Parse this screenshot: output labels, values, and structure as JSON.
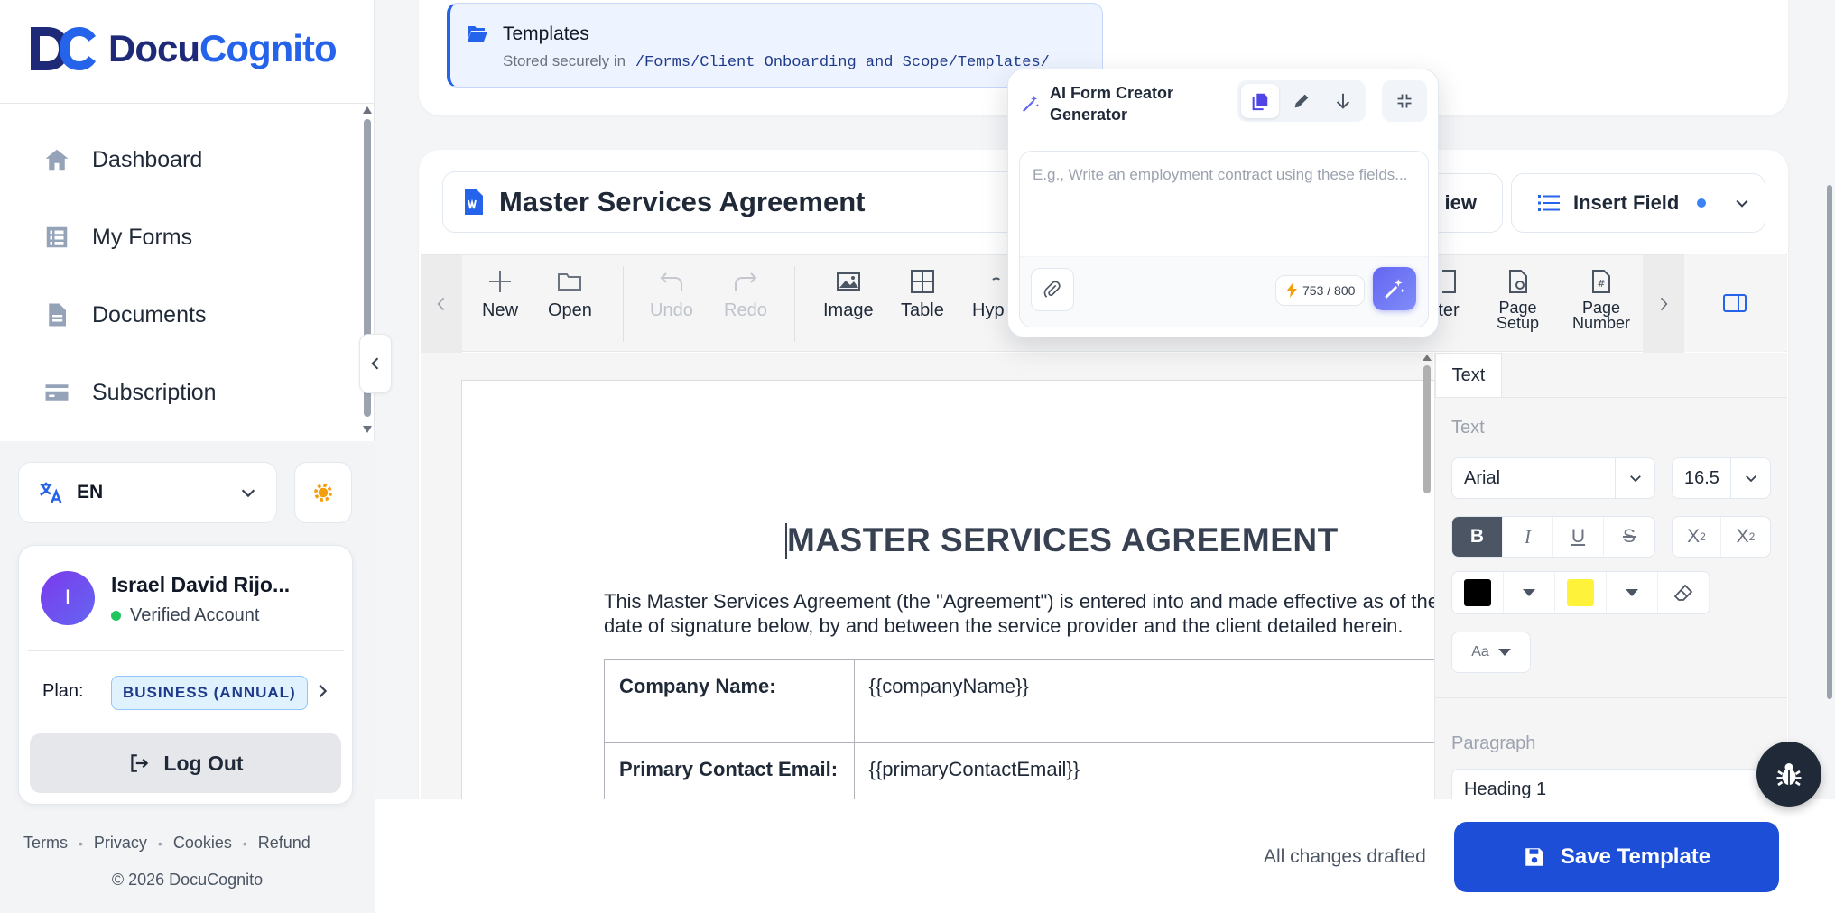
{
  "brand": {
    "part1": "Docu",
    "part2": "Cognito"
  },
  "nav": [
    {
      "label": "Dashboard",
      "icon": "home-icon"
    },
    {
      "label": "My Forms",
      "icon": "list-icon"
    },
    {
      "label": "Documents",
      "icon": "document-icon"
    },
    {
      "label": "Subscription",
      "icon": "credit-card-icon"
    }
  ],
  "language": {
    "code": "EN"
  },
  "user": {
    "initial": "I",
    "name": "Israel David Rijo...",
    "status": "Verified Account",
    "plan_label": "Plan:",
    "plan": "BUSINESS (ANNUAL)",
    "logout": "Log Out"
  },
  "footer": {
    "links": [
      "Terms",
      "Privacy",
      "Cookies",
      "Refund"
    ],
    "copyright": "© 2026  DocuCognito"
  },
  "templates_info": {
    "title": "Templates",
    "stored_prefix": "Stored securely in",
    "path": "/Forms/Client Onboarding and Scope/Templates/"
  },
  "document": {
    "title": "Master Services Agreement"
  },
  "header_buttons": {
    "preview_partial": "iew",
    "insert_field": "Insert Field"
  },
  "toolbar": {
    "new": "New",
    "open": "Open",
    "undo": "Undo",
    "redo": "Redo",
    "image": "Image",
    "table": "Table",
    "hyperlink_partial": "Hyp",
    "footer_partial": "ter",
    "page_setup_1": "Page",
    "page_setup_2": "Setup",
    "page_number_1": "Page",
    "page_number_2": "Number"
  },
  "doc_content": {
    "heading": "MASTER SERVICES AGREEMENT",
    "para_line1": "This Master Services Agreement (the \"Agreement\") is entered into and made effective as of the",
    "para_line2": "date of signature below, by and between the service provider and the client detailed herein.",
    "rows": [
      {
        "key": "Company Name:",
        "value": "{{companyName}}"
      },
      {
        "key": "Primary Contact Email:",
        "value": "{{primaryContactEmail}}"
      }
    ]
  },
  "right_panel": {
    "tab": "Text",
    "section_text": "Text",
    "font": "Arial",
    "size": "16.5",
    "case_label": "Aa",
    "section_paragraph": "Paragraph",
    "paragraph_style": "Heading 1",
    "text_color": "#000000",
    "highlight_color": "#fff23a"
  },
  "ai_popup": {
    "title": "AI Form Creator Generator",
    "placeholder": "E.g., Write an employment contract using these fields...",
    "counter": "753 / 800"
  },
  "bottom": {
    "status": "All changes drafted",
    "save": "Save Template"
  },
  "colors": {
    "accent": "#1d4ed8",
    "brand_dark": "#1e2a78",
    "ai_purple": "#6366f1"
  }
}
